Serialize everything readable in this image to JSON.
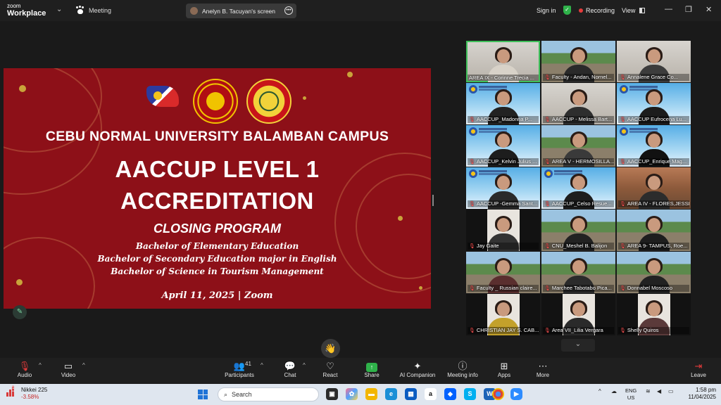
{
  "window": {
    "app_logo_line1": "zoom",
    "app_logo_line2": "Workplace",
    "meeting_label": "Meeting",
    "share_indicator": "Anelyn B. Tacuyan's screen",
    "sign_in": "Sign in",
    "recording": "Recording",
    "view": "View",
    "colors": {
      "recording_dot": "#e53b3b",
      "security_shield": "#2fb24a",
      "active_speaker": "#3fbf5a"
    }
  },
  "slide": {
    "university": "CEBU NORMAL UNIVERSITY BALAMBAN CAMPUS",
    "title_line1": "AACCUP LEVEL 1",
    "title_line2": "ACCREDITATION",
    "subtitle": "CLOSING PROGRAM",
    "programs": [
      "Bachelor of Elementary Education",
      "Bachelor of Secondary Education major in English",
      "Bachelor of Science in Tourism Management"
    ],
    "date": "April 11, 2025 | Zoom",
    "background_color": "#8d1018"
  },
  "participants": [
    {
      "name": "AREA IX - Corinne Trecia ...",
      "bg": "room",
      "shirt": "#d8d2c8",
      "muted": false,
      "active": true,
      "pic": true
    },
    {
      "name": "Faculty - Andan, Nornel...",
      "bg": "campus",
      "shirt": "#2a2a2a",
      "muted": true
    },
    {
      "name": "Annalene Grace Co...",
      "bg": "room",
      "shirt": "#3c3c3c",
      "muted": true
    },
    {
      "name": "AACCUP_Madonna P...",
      "bg": "sky",
      "shirt": "#222",
      "muted": true,
      "banner": true
    },
    {
      "name": "AACCUP - Melissa Bart...",
      "bg": "room",
      "shirt": "#2e2e2e",
      "muted": true
    },
    {
      "name": "AACCUP Eufrocena Lu...",
      "bg": "sky",
      "shirt": "#1c1c1c",
      "muted": true,
      "banner": true
    },
    {
      "name": "AACCUP_Kelvin Julius ...",
      "bg": "sky",
      "shirt": "#1d1d1d",
      "muted": true,
      "banner": true
    },
    {
      "name": "AREA V - HERMOSILLA...",
      "bg": "campus",
      "shirt": "#3a3a3a",
      "muted": true
    },
    {
      "name": "AACCUP_Enrique Mag...",
      "bg": "sky",
      "shirt": "#111",
      "muted": true,
      "banner": true
    },
    {
      "name": "AACCUP -Gemma Sant...",
      "bg": "sky",
      "shirt": "#2a2a2a",
      "muted": true,
      "banner": true
    },
    {
      "name": "AACCUP_Celso Resue...",
      "bg": "sky",
      "shirt": "#1e1e1e",
      "muted": true,
      "banner": true
    },
    {
      "name": "AREA IV - FLORES,JESSI...",
      "bg": "mountain",
      "shirt": "#2c2c2c",
      "muted": true,
      "pic": true
    },
    {
      "name": "Jay Gaite",
      "bg": "dark",
      "shirt": "#333",
      "muted": true,
      "pic": true
    },
    {
      "name": "CNU_Meshel B. Balijon",
      "bg": "campus",
      "shirt": "#222",
      "muted": true
    },
    {
      "name": "AREA 9- TAMPUS, Roe...",
      "bg": "campus",
      "shirt": "#1e1e1e",
      "muted": true
    },
    {
      "name": "Faculty _ Russian claire...",
      "bg": "campus",
      "shirt": "#5a2e2e",
      "muted": true
    },
    {
      "name": "Marchee Tabotabo Pica...",
      "bg": "campus",
      "shirt": "#2b2b2b",
      "muted": true
    },
    {
      "name": "Donnabel Moscoso",
      "bg": "campus",
      "shirt": "#222",
      "muted": true
    },
    {
      "name": "CHRISTIAN JAY S. CAB...",
      "bg": "dark",
      "shirt": "#c3a12b",
      "muted": true,
      "pic": true
    },
    {
      "name": "Area VII_Lilia Vergara",
      "bg": "dark",
      "shirt": "#2a2a2a",
      "muted": true,
      "pic": true
    },
    {
      "name": "Shelly Quiros",
      "bg": "dark",
      "shirt": "#5b3a3a",
      "muted": true,
      "pic": true
    }
  ],
  "toolbar": {
    "audio": "Audio",
    "video": "Video",
    "participants": "Participants",
    "participants_count": "41",
    "chat": "Chat",
    "react": "React",
    "share": "Share",
    "ai_companion": "AI Companion",
    "meeting_info": "Meeting info",
    "apps": "Apps",
    "more": "More",
    "leave": "Leave"
  },
  "taskbar": {
    "stock_name": "Nikkei 225",
    "stock_change": "-3.58%",
    "stock_badge": "1",
    "search_placeholder": "Search",
    "lang_line1": "ENG",
    "lang_line2": "US",
    "time": "1:58 pm",
    "date": "11/04/2025"
  }
}
